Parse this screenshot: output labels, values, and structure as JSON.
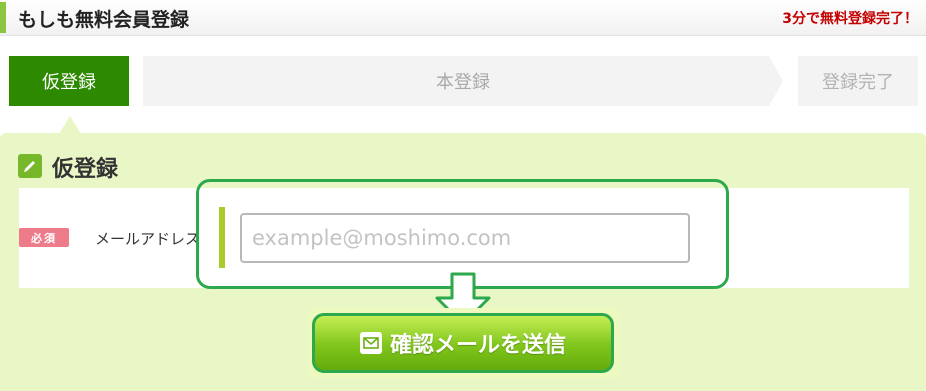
{
  "header": {
    "title": "もしも無料会員登録",
    "note": "3分で無料登録完了！"
  },
  "steps": [
    {
      "label": "仮登録",
      "state": "active"
    },
    {
      "label": "本登録",
      "state": "inactive"
    },
    {
      "label": "登録完了",
      "state": "inactive"
    }
  ],
  "section": {
    "title": "仮登録",
    "icon": "pencil-icon"
  },
  "form": {
    "required_badge": "必須",
    "email_label": "メールアドレス",
    "email_value": "",
    "email_placeholder": "example@moshimo.com"
  },
  "submit": {
    "label": "確認メールを送信",
    "icon": "mail-icon"
  },
  "colors": {
    "accent_green": "#2d8a00",
    "highlight_green": "#2ea84d",
    "panel_bg": "#e9f6c5",
    "required_pink": "#ee7b8a",
    "header_note_red": "#c40000"
  }
}
